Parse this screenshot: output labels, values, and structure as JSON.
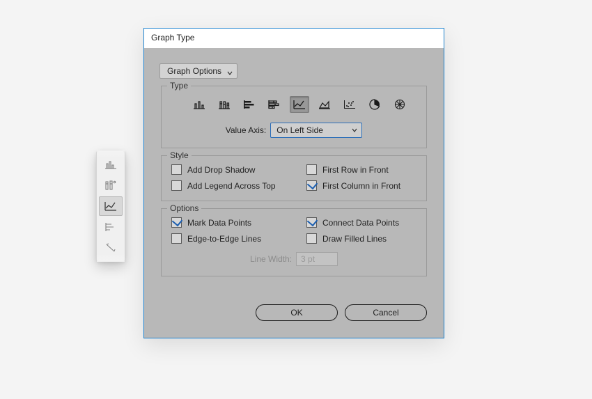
{
  "dialog": {
    "title": "Graph Type",
    "dropdown": "Graph Options",
    "type": {
      "section_title": "Type",
      "value_axis_label": "Value Axis:",
      "value_axis_value": "On Left Side"
    },
    "style": {
      "section_title": "Style",
      "add_drop_shadow": "Add Drop Shadow",
      "first_row_in_front": "First Row in Front",
      "add_legend_across_top": "Add Legend Across Top",
      "first_column_in_front": "First Column in Front"
    },
    "options": {
      "section_title": "Options",
      "mark_data_points": "Mark Data Points",
      "connect_data_points": "Connect Data Points",
      "edge_to_edge_lines": "Edge-to-Edge Lines",
      "draw_filled_lines": "Draw Filled Lines",
      "line_width_label": "Line Width:",
      "line_width_value": "3 pt"
    },
    "buttons": {
      "ok": "OK",
      "cancel": "Cancel"
    }
  },
  "checkboxes": {
    "add_drop_shadow": false,
    "first_row_in_front": false,
    "add_legend_across_top": false,
    "first_column_in_front": true,
    "mark_data_points": true,
    "connect_data_points": true,
    "edge_to_edge_lines": false,
    "draw_filled_lines": false
  },
  "graph_types": {
    "selected_index": 4,
    "items": [
      "column",
      "stacked-column",
      "bar",
      "stacked-bar",
      "line",
      "area",
      "scatter",
      "pie",
      "radar"
    ]
  },
  "toolbar": {
    "items": [
      "column-graph-tool",
      "stacked-column-graph-tool",
      "line-graph-tool",
      "bar-graph-tool",
      "area-graph-tool"
    ],
    "selected_index": 2
  }
}
